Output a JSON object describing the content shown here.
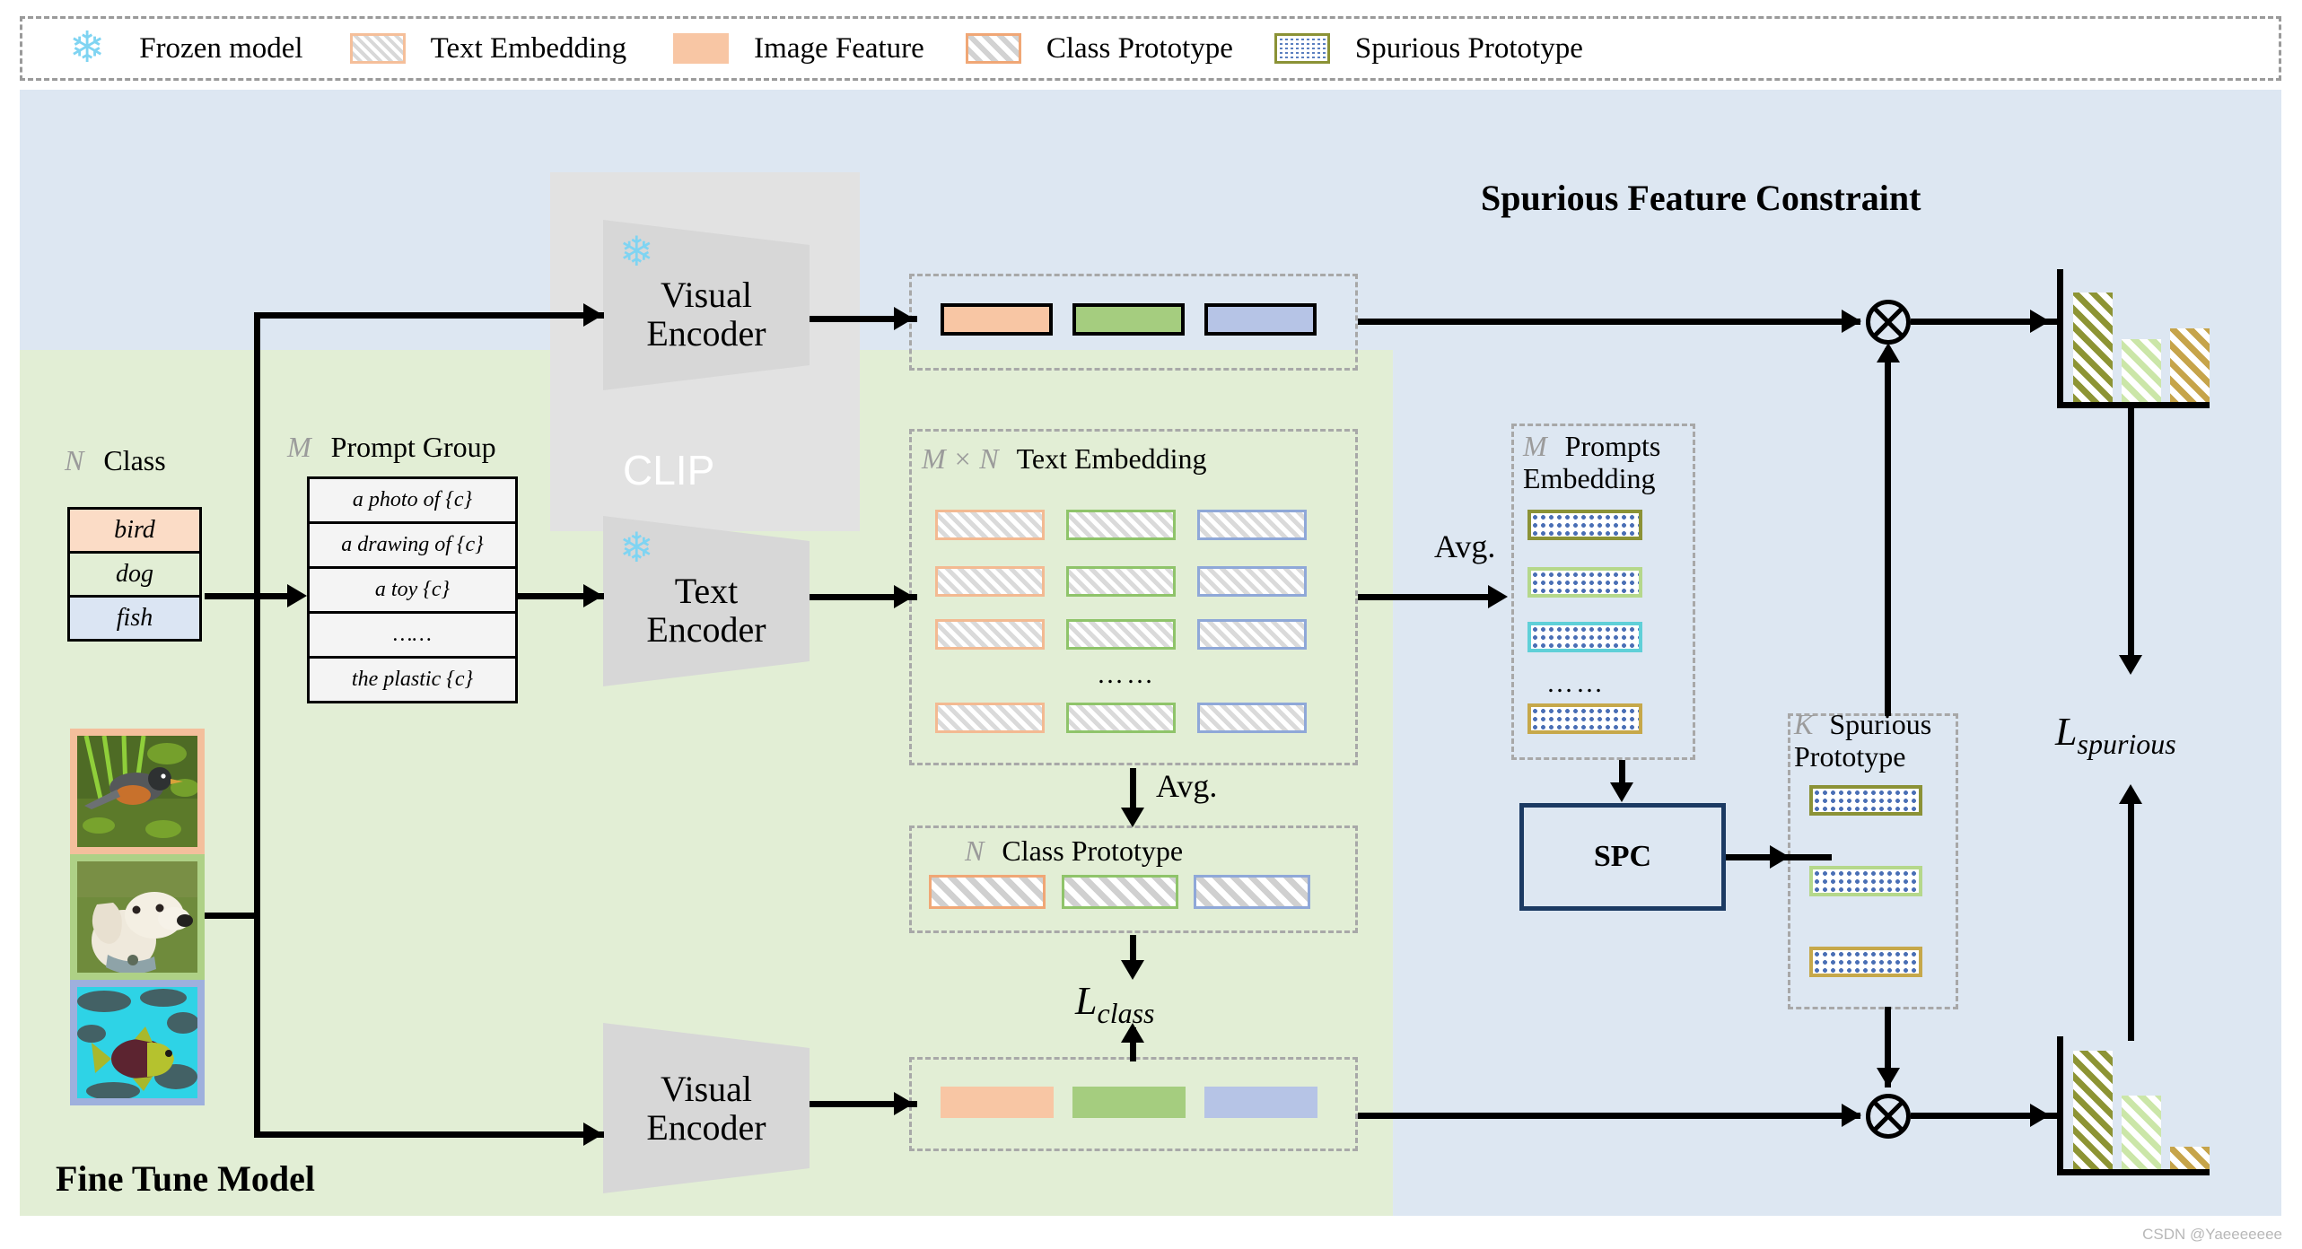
{
  "legend": {
    "items": [
      {
        "label": "Frozen model",
        "icon": "snowflake-icon"
      },
      {
        "label": "Text Embedding",
        "swatch": "text-embedding-swatch"
      },
      {
        "label": "Image Feature",
        "swatch": "image-feature-swatch"
      },
      {
        "label": "Class Prototype",
        "swatch": "class-prototype-swatch"
      },
      {
        "label": "Spurious Prototype",
        "swatch": "spurious-prototype-swatch"
      }
    ]
  },
  "titles": {
    "spurious_region": "Spurious Feature Constraint",
    "fine_tune_region": "Fine Tune Model",
    "clip": "CLIP"
  },
  "class_box": {
    "symbol": "N",
    "header": "Class",
    "items": [
      {
        "label": "bird",
        "color": "#fbdcc6"
      },
      {
        "label": "dog",
        "color": "#e2eed5"
      },
      {
        "label": "fish",
        "color": "#dbe5f3"
      }
    ]
  },
  "prompt_box": {
    "symbol": "M",
    "header": "Prompt Group",
    "items": [
      "a photo of {c}",
      "a drawing of {c}",
      "a toy {c}",
      "……",
      "the plastic {c}"
    ]
  },
  "encoders": {
    "visual_top": "Visual\nEncoder",
    "text": "Text\nEncoder",
    "visual_bottom": "Visual\nEncoder"
  },
  "image_feature_top": {
    "bars": [
      {
        "color": "#f8c6a4"
      },
      {
        "color": "#a5cd7f"
      },
      {
        "color": "#b6c4e6"
      }
    ]
  },
  "image_feature_bottom": {
    "bars": [
      {
        "color": "#f8c6a4"
      },
      {
        "color": "#a5cd7f"
      },
      {
        "color": "#b6c4e6"
      }
    ]
  },
  "text_embedding": {
    "symbol": "M × N",
    "header": "Text Embedding",
    "column_colors": [
      "#f3ba92",
      "#8fc46a",
      "#8fa8d8"
    ],
    "rows": 4,
    "ellipsis": "……"
  },
  "class_prototype": {
    "symbol": "N",
    "header": "Class Prototype",
    "bar_colors": [
      "#f0a776",
      "#8fc46a",
      "#8fa8d8"
    ]
  },
  "prompts_embedding": {
    "symbol": "M",
    "header": "Prompts Embedding",
    "bar_colors": [
      "#8b9236",
      "#b5d88b",
      "#5fd0d8",
      "#c6a84a"
    ],
    "ellipsis": "……"
  },
  "spurious_prototype": {
    "symbol": "K",
    "header": "Spurious Prototype",
    "bar_colors": [
      "#8b9236",
      "#b5d88b",
      "#c6a84a"
    ]
  },
  "spc": {
    "label": "SPC"
  },
  "operators": {
    "avg_text_to_class": "Avg.",
    "avg_text_to_prompts": "Avg.",
    "multiply_top": "⊗",
    "multiply_bottom": "⊗"
  },
  "losses": {
    "class": "L",
    "class_sub": "class",
    "spurious": "L",
    "spurious_sub": "spurious"
  },
  "photos": [
    {
      "name": "bird-photo",
      "frame": "#f4bf9c"
    },
    {
      "name": "dog-photo",
      "frame": "#aed186"
    },
    {
      "name": "fish-photo",
      "frame": "#9eb0dd"
    }
  ],
  "chart_data": [
    {
      "type": "bar",
      "title": "",
      "name": "top-right-similarity-histogram",
      "categories": [
        "prototype-1",
        "prototype-2",
        "prototype-3"
      ],
      "values": [
        82,
        47,
        55
      ],
      "bar_styles": [
        "olive-hatch",
        "light-green-hatch",
        "gold-hatch"
      ],
      "xlabel": "",
      "ylabel": "",
      "ylim": [
        0,
        100
      ],
      "grid": false,
      "legend": "none"
    },
    {
      "type": "bar",
      "title": "",
      "name": "bottom-right-similarity-histogram",
      "categories": [
        "prototype-1",
        "prototype-2",
        "prototype-3"
      ],
      "values": [
        88,
        55,
        16
      ],
      "bar_styles": [
        "olive-hatch",
        "light-green-hatch",
        "gold-hatch"
      ],
      "xlabel": "",
      "ylabel": "",
      "ylim": [
        0,
        100
      ],
      "grid": false,
      "legend": "none"
    }
  ],
  "watermark": "CSDN @Yaeeeeeee"
}
